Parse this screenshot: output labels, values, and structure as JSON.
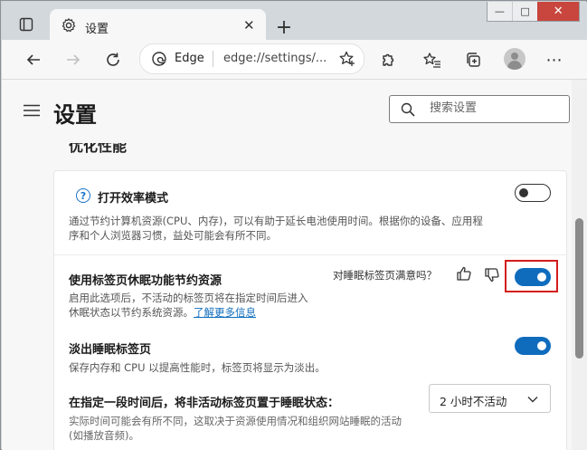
{
  "window": {
    "minimize": "—",
    "maximize": "□",
    "close": "✕"
  },
  "tab": {
    "title": "设置",
    "close": "✕"
  },
  "newtab": "+",
  "address": {
    "brand": "Edge",
    "url": "edge://settings/..."
  },
  "header": {
    "title": "设置",
    "search_placeholder": "搜索设置"
  },
  "section": {
    "title": "优化性能"
  },
  "efficiency": {
    "help": "?",
    "title": "打开效率模式",
    "desc_line1": "通过节约计算机资源(CPU、内存)，可以有助于延长电池使用时间。根据你的设备、应用程",
    "desc_line2": "序和个人浏览器习惯，益处可能会有所不同。",
    "enabled": false
  },
  "sleeping_tabs": {
    "title": "使用标签页休眠功能节约资源",
    "feedback_prompt": "对睡眠标签页满意吗？",
    "desc_line1": "启用此选项后，不活动的标签页将在指定时间后进入",
    "desc_line2": "休眠状态以节约系统资源。",
    "learn_more": "了解更多信息",
    "enabled": true
  },
  "fade_tabs": {
    "title": "淡出睡眠标签页",
    "desc": "保存内存和 CPU 以提高性能时，标签页将显示为淡出。",
    "enabled": true
  },
  "sleep_after": {
    "title": "在指定一段时间后，将非活动标签页置于睡眠状态：",
    "selected": "2 小时不活动",
    "desc_line1": "实际时间可能会有所不同，这取决于资源使用情况和组织网站睡眠的活动",
    "desc_line2": "(如播放音频)。"
  },
  "colors": {
    "accent": "#0f6cbd",
    "highlight": "#d41c1c",
    "close": "#c8463d"
  }
}
